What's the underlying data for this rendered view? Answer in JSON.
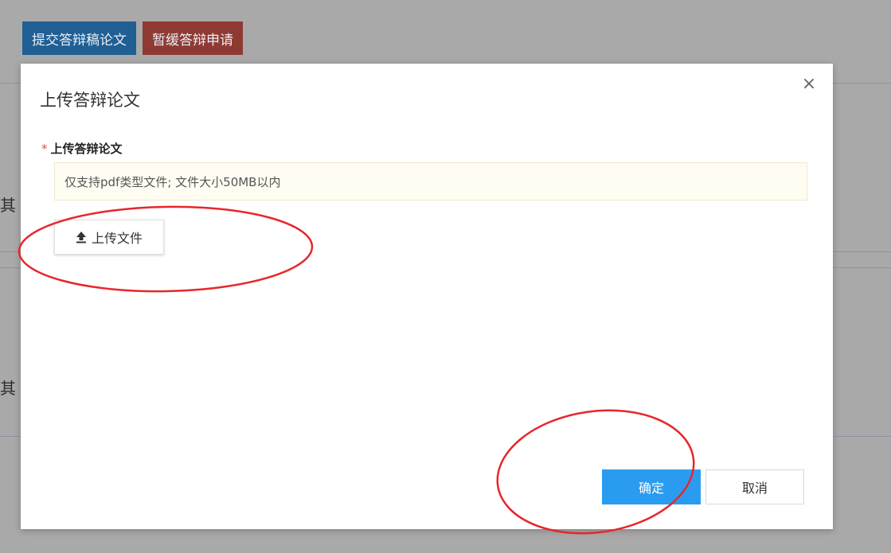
{
  "background": {
    "toolbar": {
      "submit_label": "提交答辩稿论文",
      "defer_label": "暂缓答辩申请"
    },
    "edge_text_1": "其",
    "edge_text_2": "其"
  },
  "modal": {
    "title": "上传答辩论文",
    "close_symbol": "×",
    "field_label": "上传答辩论文",
    "required_mark": "*",
    "notice": "仅支持pdf类型文件; 文件大小50MB以内",
    "upload_label": "上传文件",
    "confirm_label": "确定",
    "cancel_label": "取消"
  },
  "colors": {
    "primary": "#2a9cf0",
    "annotation": "#e8262a",
    "required": "#e04f3b",
    "bg_primary": "#1f5f94",
    "bg_danger": "#8e3a33"
  },
  "icons": [
    "upload-icon",
    "close-icon"
  ]
}
